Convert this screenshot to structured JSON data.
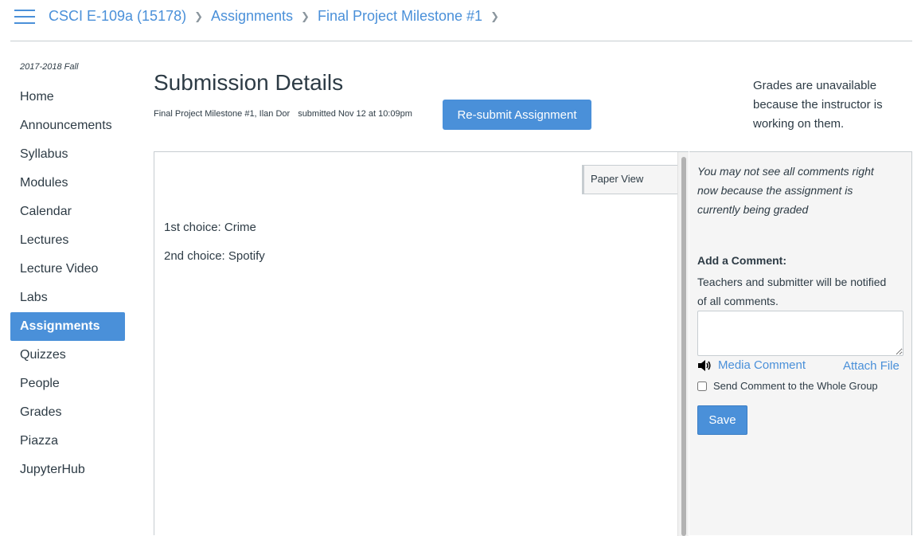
{
  "breadcrumb": {
    "items": [
      "CSCI E-109a (15178)",
      "Assignments",
      "Final Project Milestone #1"
    ]
  },
  "sidebar": {
    "term": "2017-2018 Fall",
    "items": [
      {
        "label": "Home"
      },
      {
        "label": "Announcements"
      },
      {
        "label": "Syllabus"
      },
      {
        "label": "Modules"
      },
      {
        "label": "Calendar"
      },
      {
        "label": "Lectures"
      },
      {
        "label": "Lecture Video"
      },
      {
        "label": "Labs"
      },
      {
        "label": "Assignments",
        "active": true
      },
      {
        "label": "Quizzes"
      },
      {
        "label": "People"
      },
      {
        "label": "Grades"
      },
      {
        "label": "Piazza"
      },
      {
        "label": "JupyterHub"
      }
    ]
  },
  "main": {
    "title": "Submission Details",
    "submission_info": "Final Project Milestone #1, Ilan Dor",
    "submitted_at": "submitted Nov 12 at 10:09pm",
    "resubmit_label": "Re-submit Assignment",
    "grades_note": "Grades are unavailable because the instructor is working on them."
  },
  "submission": {
    "paper_view_label": "Paper View",
    "lines": [
      "1st choice: Crime",
      "2nd choice: Spotify"
    ]
  },
  "comments": {
    "notice": "You may not see all comments right now because the assignment is currently being graded",
    "add_label": "Add a Comment:",
    "notify_text": "Teachers and submitter will be notified of all comments.",
    "comment_value": "",
    "media_comment_label": "Media Comment",
    "attach_file_label": "Attach File",
    "group_checkbox_label": "Send Comment to the Whole Group",
    "group_checked": false,
    "save_label": "Save"
  },
  "icons": {
    "menu": "hamburger-menu-icon",
    "breadcrumb_separator": "chevron-right-icon",
    "media": "speaker-icon"
  },
  "colors": {
    "accent": "#4a90d9",
    "text": "#2d3b45",
    "panel_bg": "#f5f5f5",
    "border": "#c7cdd1"
  }
}
